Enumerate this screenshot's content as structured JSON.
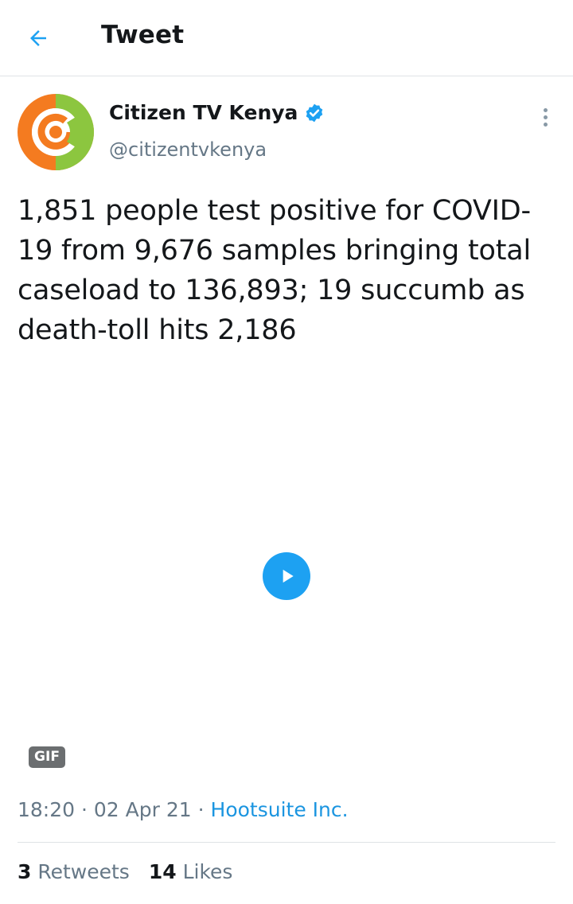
{
  "header": {
    "title": "Tweet",
    "back_icon": "arrow-left-icon"
  },
  "author": {
    "display_name": "Citizen TV Kenya",
    "handle": "@citizentvkenya",
    "verified": true,
    "avatar_colors": {
      "orange": "#f47b20",
      "green": "#8cc63f"
    }
  },
  "tweet": {
    "text": "1,851 people test positive for COVID-19 from 9,676 samples bringing total caseload to 136,893; 19 succumb as death-toll hits 2,186",
    "media_badge": "GIF"
  },
  "meta": {
    "time": "18:20",
    "separator": "·",
    "date": "02 Apr 21",
    "source": "Hootsuite Inc."
  },
  "stats": {
    "retweets_count": "3",
    "retweets_label": "Retweets",
    "likes_count": "14",
    "likes_label": "Likes"
  },
  "colors": {
    "accent": "#1da1f2",
    "link": "#1b95e0",
    "secondary_text": "#657786"
  }
}
